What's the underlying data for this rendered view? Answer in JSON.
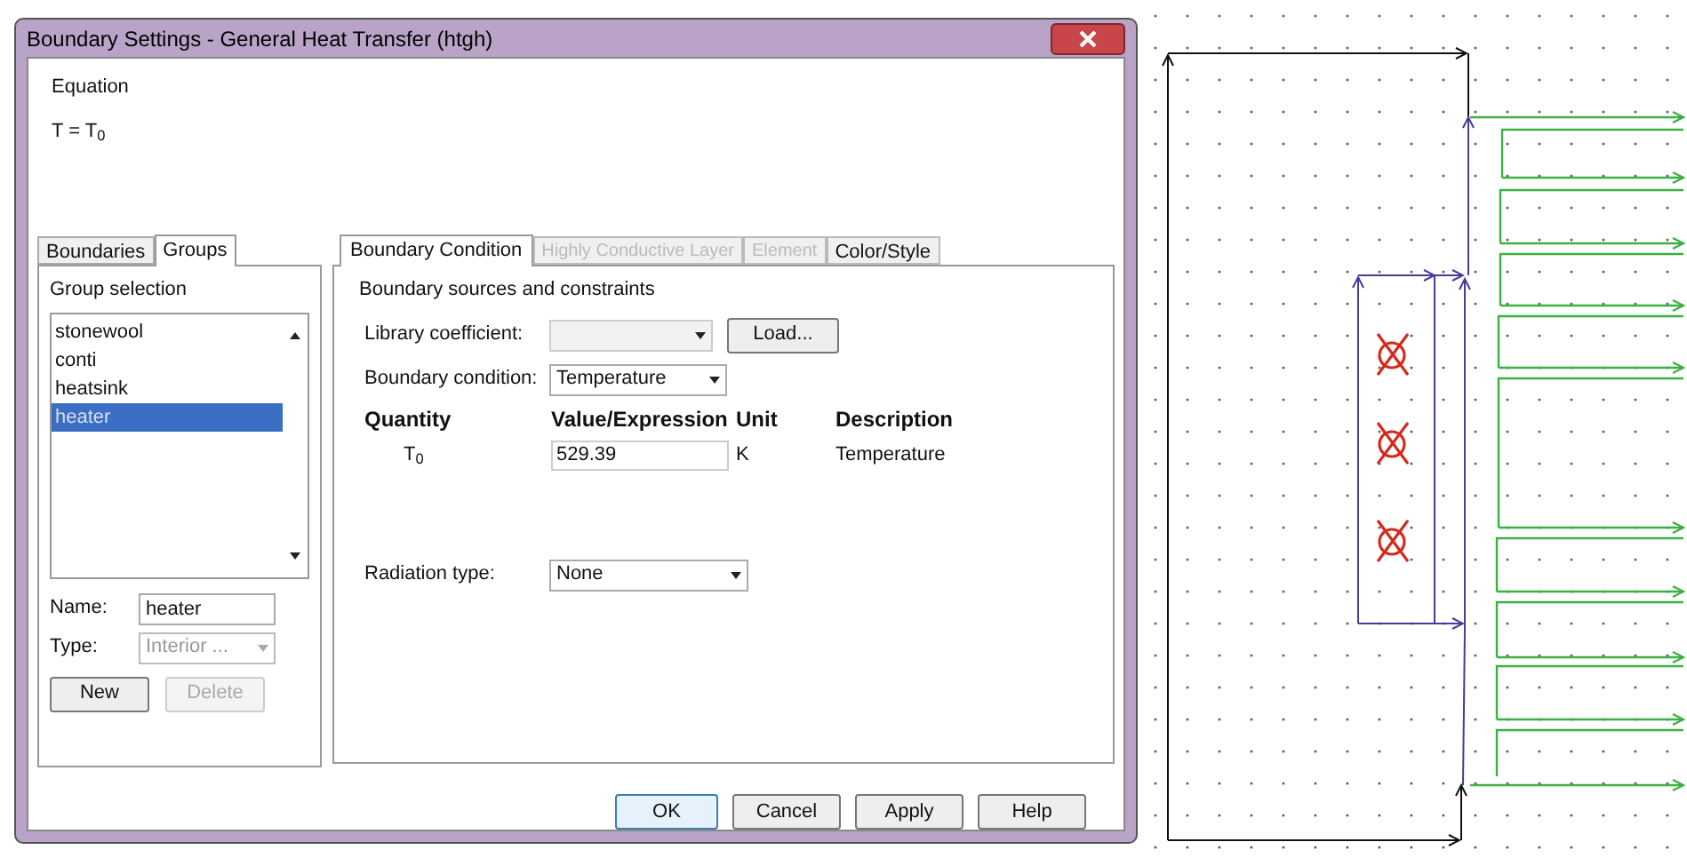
{
  "window": {
    "title": "Boundary Settings - General Heat Transfer (htgh)"
  },
  "equation": {
    "label": "Equation",
    "formula": "T = T$_{0}$"
  },
  "left_tabs": [
    {
      "label": "Boundaries",
      "selected": false
    },
    {
      "label": "Groups",
      "selected": true
    }
  ],
  "group_selection": {
    "label": "Group selection",
    "items": [
      {
        "label": "stonewool",
        "selected": false
      },
      {
        "label": "conti",
        "selected": false
      },
      {
        "label": "heatsink",
        "selected": false
      },
      {
        "label": "heater",
        "selected": true
      }
    ],
    "name": {
      "label": "Name:",
      "value": "heater"
    },
    "type": {
      "label": "Type:",
      "value": "Interior ...",
      "disabled": true
    },
    "buttons": [
      {
        "label": "New",
        "disabled": false
      },
      {
        "label": "Delete",
        "disabled": true
      }
    ]
  },
  "right_tabs": [
    {
      "label": "Boundary Condition",
      "selected": true,
      "disabled": false
    },
    {
      "label": "Highly Conductive Layer",
      "selected": false,
      "disabled": true
    },
    {
      "label": "Element",
      "selected": false,
      "disabled": true
    },
    {
      "label": "Color/Style",
      "selected": false,
      "disabled": false
    }
  ],
  "boundary": {
    "section": "Boundary sources and constraints",
    "library_coefficient": {
      "label": "Library coefficient:",
      "disabled": true
    },
    "load_button": "Load...",
    "boundary_condition": {
      "label": "Boundary condition:",
      "value": "Temperature"
    },
    "columns": [
      "Quantity",
      "Value/Expression",
      "Unit",
      "Description"
    ],
    "rows": [
      {
        "quantity": "T$_{0}$",
        "value": "529.39",
        "unit": "K",
        "description": "Temperature"
      }
    ],
    "radiation_type": {
      "label": "Radiation type:",
      "value": "None"
    }
  },
  "footer_buttons": [
    {
      "label": "OK",
      "default": true
    },
    {
      "label": "Cancel",
      "default": false
    },
    {
      "label": "Apply",
      "default": false
    },
    {
      "label": "Help",
      "default": false
    }
  ]
}
